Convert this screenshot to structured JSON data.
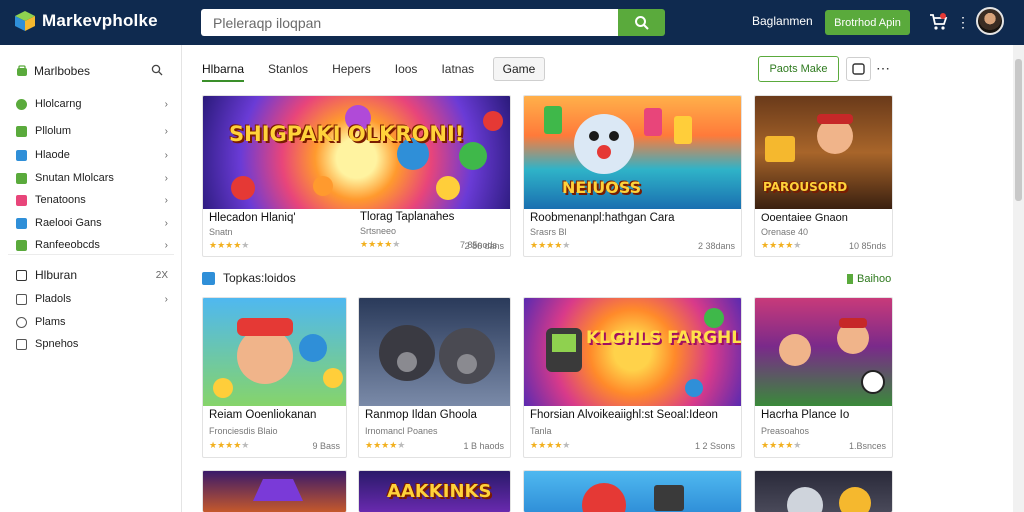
{
  "app": {
    "name": "Markevpholke"
  },
  "search": {
    "placeholder": "Pleleraqp iloqpan"
  },
  "topbar": {
    "link_label": "Baglanmen",
    "cta_label": "Brotrhod Apin"
  },
  "sidebar": {
    "header": "Marlbobes",
    "items": [
      {
        "label": "Hlolcarng",
        "color": "#5aaa3c",
        "chevron": "›"
      },
      {
        "label": "Pllolum",
        "color": "#5aaa3c",
        "chevron": "›"
      },
      {
        "label": "Hlaode",
        "color": "#2f8fd8",
        "chevron": "›"
      },
      {
        "label": "Snutan Mlolcars",
        "color": "#5aaa3c",
        "chevron": "›"
      },
      {
        "label": "Tenatoons",
        "color": "#e8457a",
        "chevron": "›"
      },
      {
        "label": "Raelooi Gans",
        "color": "#2f8fd8",
        "chevron": "›"
      },
      {
        "label": "Ranfeeobcds",
        "color": "#5aaa3c",
        "chevron": "›"
      }
    ],
    "group": {
      "label": "Hlburan",
      "aside": "2X"
    },
    "sub_items": [
      {
        "label": "Pladols",
        "chevron": "›"
      },
      {
        "label": "Plams",
        "chevron": ""
      },
      {
        "label": "Spnehos",
        "chevron": ""
      }
    ]
  },
  "tabs": [
    "Hlbarna",
    "Stanlos",
    "Hepers",
    "Ioos",
    "Iatnas"
  ],
  "tab_chip": "Game",
  "actions": {
    "outline_label": "Paots Make"
  },
  "featured": [
    {
      "title": "Hlecadon Hlaniq'",
      "subtitle": "Snatn",
      "count": "2 86 dans",
      "art_text": "SHIGPAKI OLKRONI!"
    },
    {
      "title": "Tlorag Taplanahes",
      "subtitle": "Srtsneeo",
      "count": "7 85nods",
      "art_text": ""
    },
    {
      "title": "Roobmenanpl:hathgan Cara",
      "subtitle": "Srasrs Bl",
      "count": "2 38dans",
      "art_text": "NEIUOSS"
    },
    {
      "title": "Ooentaiee Gnaon",
      "subtitle": "Orenase 40",
      "count": "10 85nds",
      "art_text": "PAROUSORD"
    }
  ],
  "section": {
    "title": "Topkas:loidos",
    "link_label": "Baihoo"
  },
  "grid": [
    {
      "title": "Reiam Ooenliokanan",
      "subtitle": "Fronciesdis Blaio",
      "count": "9 Bass"
    },
    {
      "title": "Ranmop Ildan Ghoola",
      "subtitle": "Irnomancl Poanes",
      "count": "1 B haods"
    },
    {
      "title": "Fhorsian Alvoikeaiighl:st Seoal:Ideon",
      "subtitle": "Tanla",
      "count": "1 2 Ssons",
      "art_text": "KLGHLS FARGHLES SOSSON"
    },
    {
      "title": "Hacrha Plance Io",
      "subtitle": "Preasoahos",
      "count": "1.Bsnces"
    }
  ],
  "bottom_row": [
    {
      "art_text": ""
    },
    {
      "art_text": "AAKKINKS"
    },
    {
      "art_text": ""
    },
    {
      "art_text": ""
    }
  ],
  "colors": {
    "topbar": "#0f2a4f",
    "accent_green": "#5aaa3c",
    "star": "#f2b01e"
  }
}
